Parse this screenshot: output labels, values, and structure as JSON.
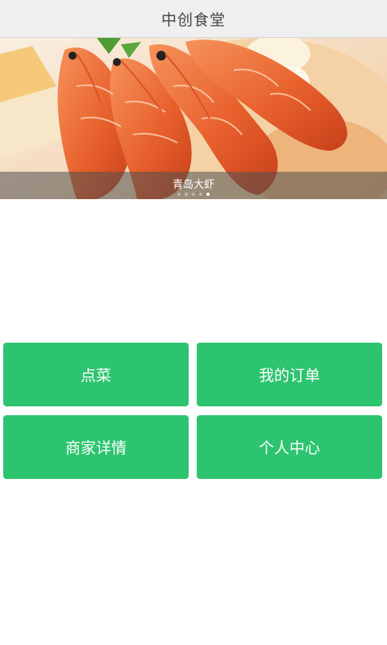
{
  "header": {
    "title": "中创食堂"
  },
  "banner": {
    "caption": "青岛大虾",
    "image": "shrimp-dish-photo",
    "slide_count": 5,
    "active_slide": 5
  },
  "menu": {
    "tiles": [
      {
        "label": "点菜"
      },
      {
        "label": "我的订单"
      },
      {
        "label": "商家详情"
      },
      {
        "label": "个人中心"
      }
    ]
  },
  "colors": {
    "accent": "#2dc46f",
    "header_bg": "#efefef",
    "header_text": "#444444"
  }
}
